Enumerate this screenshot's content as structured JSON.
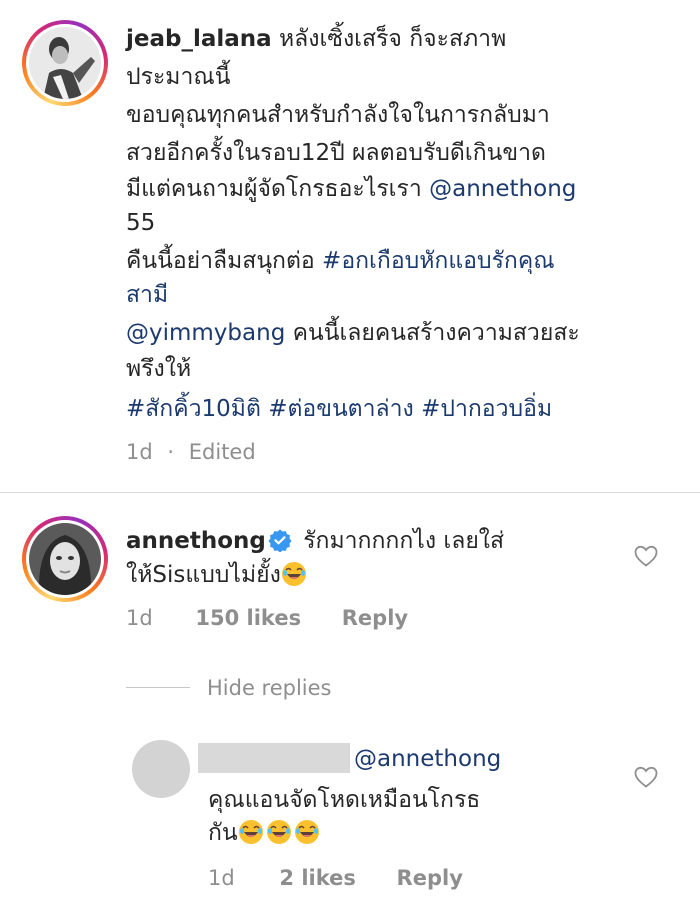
{
  "post": {
    "username": "jeab_lalana",
    "caption_line1": "หลังเซิ้งเสร็จ ก็จะสภาพ",
    "caption_line2": "ประมาณนี้",
    "caption_line3": "ขอบคุณทุกคนสำหรับกำลังใจในการกลับมา",
    "caption_line4": "สวยอีกครั้งในรอบ12ปี ผลตอบรับดีเกินขาด",
    "caption_line5_text": "มีแต่คนถามผู้จัดโกรธอะไรเรา ",
    "caption_line5_mention": "@annethong",
    "caption_line6": "55",
    "caption_line7_text": "คืนนี้อย่าลืมสนุกต่อ ",
    "caption_line7_hashtag": "#อกเกือบหักแอบรักคุณ",
    "caption_line8_hashtag": "สามี",
    "caption_line9_mention": "@yimmybang",
    "caption_line9_text": " คนนี้เลยคนสร้างความสวยสะ",
    "caption_line10": "พรึงให้",
    "hashtags": [
      "#สักคิ้ว10มิติ",
      "#ต่อขนตาล่าง",
      "#ปากอวบอิ่ม"
    ],
    "time": "1d",
    "separator": "·",
    "edited": "Edited"
  },
  "comment": {
    "username": "annethong",
    "text_line1": "รักมากกกกไง เลยใส่",
    "text_line2": "ให้Sisแบบไม่ยั้ง",
    "time": "1d",
    "likes": "150 likes",
    "reply_label": "Reply",
    "hide_replies": "Hide replies"
  },
  "reply": {
    "mention": "@annethong",
    "text_line1": "คุณแอนจัดโหดเหมือนโกรธ",
    "text_line2": "กัน",
    "time": "1d",
    "likes": "2 likes",
    "reply_label": "Reply"
  },
  "icons": {
    "heart": "heart-outline-icon",
    "verified": "verified-badge-icon",
    "emoji_laugh": "rolling-on-floor-laughing-emoji"
  },
  "colors": {
    "link": "#1c3a6e",
    "meta": "#8e8e8e",
    "verified": "#3897f0",
    "emoji": "#fbc02d"
  }
}
